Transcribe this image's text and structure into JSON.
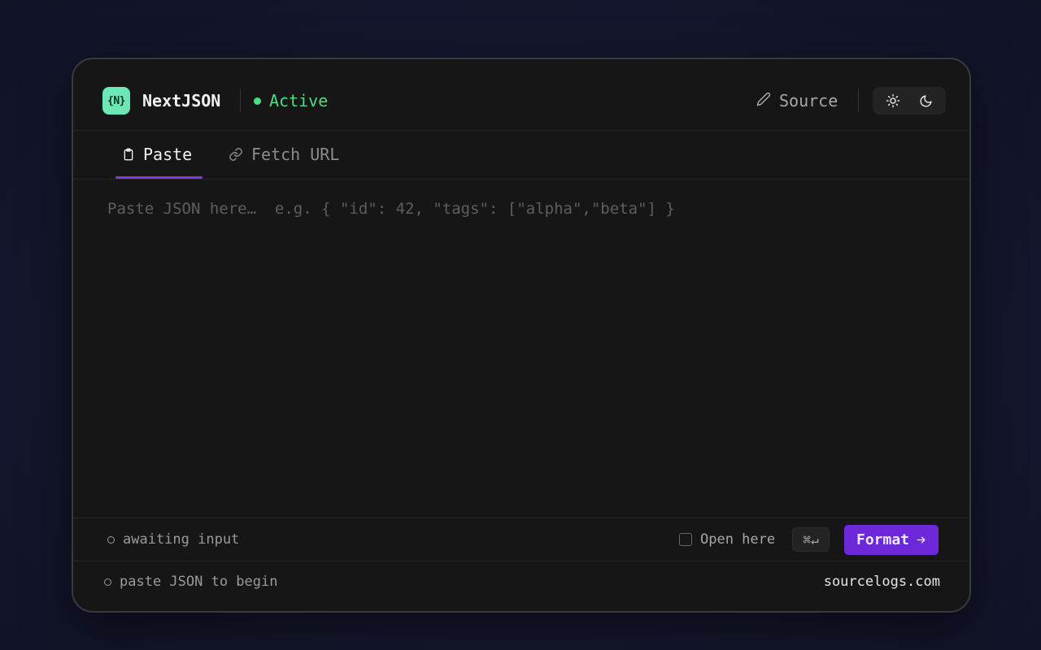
{
  "header": {
    "logo_text": "{N}",
    "app_name": "NextJSON",
    "status_label": "Active",
    "source_label": "Source",
    "theme_options": [
      "light",
      "dark"
    ]
  },
  "tabs": [
    {
      "label": "Paste",
      "icon": "clipboard-icon",
      "active": true
    },
    {
      "label": "Fetch URL",
      "icon": "link-icon",
      "active": false
    }
  ],
  "editor": {
    "placeholder": "Paste JSON here…  e.g. { \"id\": 42, \"tags\": [\"alpha\",\"beta\"] }",
    "value": ""
  },
  "action_bar": {
    "status_text": "awaiting input",
    "open_here_label": "Open here",
    "open_here_checked": false,
    "shortcut": "⌘↵",
    "format_label": "Format"
  },
  "footer": {
    "hint": "paste JSON to begin",
    "link_text": "sourcelogs.com"
  },
  "colors": {
    "accent": "#6d28d9",
    "status": "#4ade80",
    "logo": "#6ee7b7"
  }
}
